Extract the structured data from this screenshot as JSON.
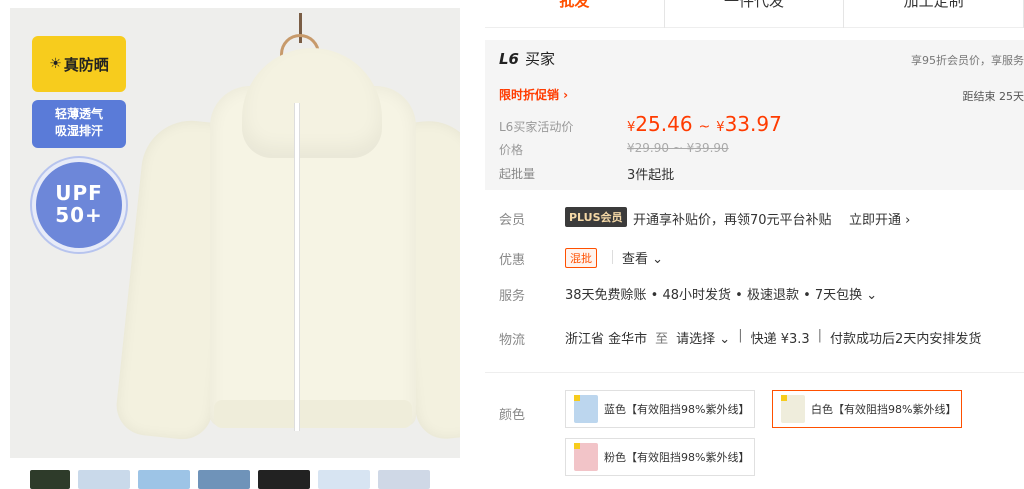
{
  "gallery": {
    "badges": {
      "sun_protect": "真防晒",
      "breathable_line1": "轻薄透气",
      "breathable_line2": "吸湿排汗",
      "upf_line1": "UPF",
      "upf_line2": "50+"
    },
    "thumbnail_count": 7
  },
  "mode_tabs": [
    {
      "label": "批发",
      "active": true
    },
    {
      "label": "一件代发",
      "active": false
    },
    {
      "label": "加工定制",
      "active": false
    }
  ],
  "buyer": {
    "level": "L6",
    "name": "买家",
    "benefit": "享95折会员价，享服务"
  },
  "promo": {
    "tag": "限时折促销 ›",
    "countdown": "距结束 25天"
  },
  "price": {
    "activity_label": "L6买家活动价",
    "currency": "¥",
    "low": "25.46",
    "tilde": "~",
    "high": "33.97",
    "orig_label": "价格",
    "orig": "¥29.90 ~ ¥39.90",
    "moq_label": "起批量",
    "moq": "3件起批"
  },
  "membership": {
    "label": "会员",
    "badge": "PLUS会员",
    "text": "开通享补贴价，再领70元平台补贴",
    "link": "立即开通 ›"
  },
  "discount": {
    "label": "优惠",
    "badge": "混批",
    "link": "查看 ⌄"
  },
  "service": {
    "label": "服务",
    "text": "38天免费赊账 • 48小时发货 • 极速退款 • 7天包换 ⌄"
  },
  "logistics": {
    "label": "物流",
    "origin": "浙江省 金华市",
    "to": "至",
    "destination": "请选择 ⌄",
    "express": "快递 ¥3.3",
    "ship_note": "付款成功后2天内安排发货"
  },
  "colors": {
    "label": "颜色",
    "options": [
      {
        "name": "蓝色【有效阻挡98%紫外线】",
        "selected": false
      },
      {
        "name": "白色【有效阻挡98%紫外线】",
        "selected": true
      },
      {
        "name": "粉色【有效阻挡98%紫外线】",
        "selected": false
      }
    ]
  },
  "accent_color": "#ff5000"
}
